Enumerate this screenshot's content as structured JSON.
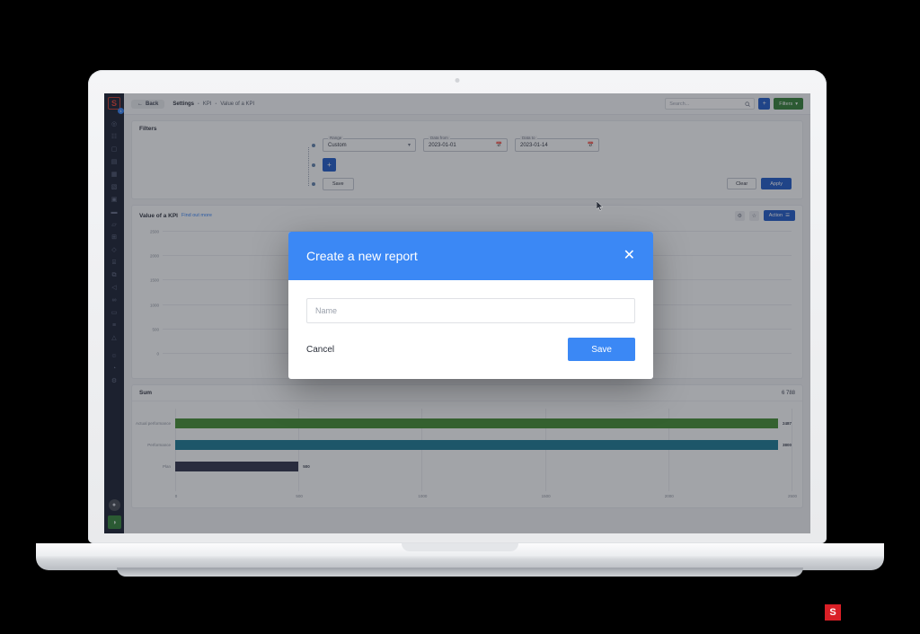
{
  "app": {
    "brand_initial": "S",
    "badge": "1"
  },
  "topbar": {
    "back_label": "Back",
    "breadcrumb": [
      "Settings",
      "KPI",
      "Value of a KPI"
    ],
    "breadcrumb_sep": "•",
    "search_placeholder": "Search...",
    "add_label": "+",
    "filters_label": "Filters",
    "filters_color": "#2f7d32",
    "primary_color": "#1a56c4"
  },
  "sidebar": {
    "items": [
      {
        "name": "sidebar-item-dashboard",
        "icon": "◎"
      },
      {
        "name": "sidebar-item-analytics",
        "icon": "☷"
      },
      {
        "name": "sidebar-item-monitor",
        "icon": "▢"
      },
      {
        "name": "sidebar-item-reports",
        "icon": "▤"
      },
      {
        "name": "sidebar-item-cards",
        "icon": "▦"
      },
      {
        "name": "sidebar-item-tasks",
        "icon": "▧"
      },
      {
        "name": "sidebar-item-calendar",
        "icon": "▣"
      },
      {
        "name": "sidebar-item-briefcase",
        "icon": "▬"
      },
      {
        "name": "sidebar-item-folder",
        "icon": "▱"
      },
      {
        "name": "sidebar-item-grid",
        "icon": "⊞"
      },
      {
        "name": "sidebar-item-tag",
        "icon": "◇"
      },
      {
        "name": "sidebar-item-table",
        "icon": "⌸"
      },
      {
        "name": "sidebar-item-layers",
        "icon": "⧉"
      },
      {
        "name": "sidebar-item-send",
        "icon": "◁"
      },
      {
        "name": "sidebar-item-link",
        "icon": "∞"
      },
      {
        "name": "sidebar-item-window",
        "icon": "▭"
      },
      {
        "name": "sidebar-item-database",
        "icon": "≡"
      },
      {
        "name": "sidebar-item-notifications",
        "icon": "△"
      },
      {
        "name": "sidebar-item-users",
        "icon": "☺"
      },
      {
        "name": "sidebar-item-support",
        "icon": "◔"
      },
      {
        "name": "sidebar-item-settings",
        "icon": "⚙"
      }
    ],
    "avatar_glyph": "●",
    "action_glyph": "◑"
  },
  "filters_card": {
    "title": "Filters",
    "range": {
      "label": "Range",
      "value": "Custom"
    },
    "date_from": {
      "label": "Data from",
      "value": "2023-01-01"
    },
    "date_to": {
      "label": "Data to",
      "value": "2023-01-14"
    },
    "add_row_label": "+",
    "save_label": "Save",
    "clear_label": "Clear",
    "apply_label": "Apply"
  },
  "kpi_card": {
    "title": "Value of a KPI",
    "link": "Find out more",
    "action_label": "Action",
    "gear_icon": "⚙",
    "star_icon": "☆",
    "menu_icon": "☰"
  },
  "sum_card": {
    "title": "Sum",
    "total": "6 788"
  },
  "modal": {
    "title": "Create a new report",
    "close_icon": "✕",
    "name_placeholder": "Name",
    "cancel_label": "Cancel",
    "save_label": "Save",
    "accent": "#3b88f5"
  },
  "corner_logo": {
    "glyph": "S",
    "color": "#d91f26"
  },
  "chart_data": [
    {
      "type": "line",
      "title": "Value of a KPI",
      "xlabel": "",
      "ylabel": "",
      "ylim": [
        0,
        2500
      ],
      "yticks": [
        "2500",
        "2000",
        "1500",
        "1000",
        "500",
        "0"
      ],
      "grid": true,
      "legend_position": "bottom",
      "series": [
        {
          "name": "Actual performance",
          "color": "#3f8a2e"
        },
        {
          "name": "Performance",
          "color": "#15768f"
        },
        {
          "name": "Plan",
          "color": "#2a2e45"
        }
      ]
    },
    {
      "type": "bar",
      "title": "Sum",
      "orientation": "horizontal",
      "total": "6 788",
      "categories": [
        "Actual performance",
        "Performance",
        "Plan"
      ],
      "values": [
        2487,
        3800,
        500
      ],
      "value_labels": [
        "2487",
        "3800",
        "500"
      ],
      "colors": [
        "#3f8a2e",
        "#15768f",
        "#2a2e45"
      ],
      "xlim": [
        0,
        2500
      ],
      "xticks": [
        "0",
        "500",
        "1000",
        "1500",
        "2000",
        "2500"
      ],
      "grid": true
    }
  ]
}
